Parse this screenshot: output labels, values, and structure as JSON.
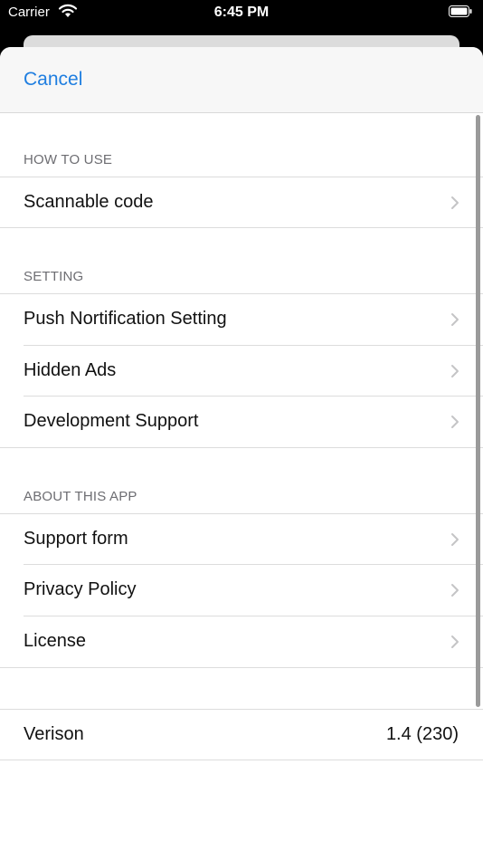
{
  "status_bar": {
    "carrier": "Carrier",
    "time": "6:45 PM"
  },
  "navbar": {
    "cancel_label": "Cancel"
  },
  "sections": {
    "how_to_use": {
      "header": "HOW TO USE",
      "items": [
        {
          "label": "Scannable code"
        }
      ]
    },
    "setting": {
      "header": "SETTING",
      "items": [
        {
          "label": "Push Nortification Setting"
        },
        {
          "label": "Hidden Ads"
        },
        {
          "label": "Development Support"
        }
      ]
    },
    "about": {
      "header": "ABOUT THIS APP",
      "items": [
        {
          "label": "Support form"
        },
        {
          "label": "Privacy Policy"
        },
        {
          "label": "License"
        }
      ]
    }
  },
  "version": {
    "label": "Verison",
    "value": "1.4 (230)"
  },
  "colors": {
    "accent": "#1f7ee0",
    "header_text": "#6d6d72",
    "separator": "#dcdcdc"
  },
  "icons": [
    "wifi-icon",
    "battery-icon",
    "chevron-right-icon"
  ]
}
